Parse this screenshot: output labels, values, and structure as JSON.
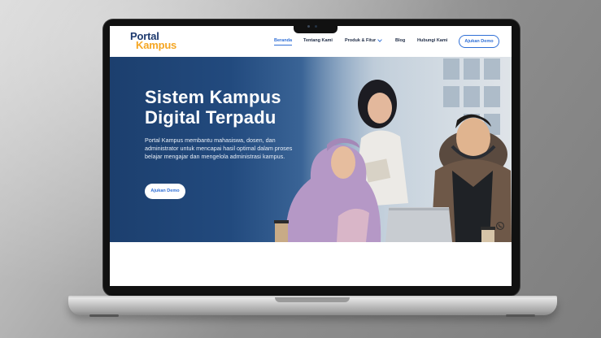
{
  "logo": {
    "line1": "Portal",
    "line2": "Kampus"
  },
  "nav": {
    "items": [
      {
        "label": "Beranda",
        "active": true
      },
      {
        "label": "Tentang Kami",
        "active": false
      },
      {
        "label": "Produk & Fitur",
        "active": false,
        "dropdown": true
      },
      {
        "label": "Blog",
        "active": false
      },
      {
        "label": "Hubungi Kami",
        "active": false
      }
    ],
    "cta_label": "Ajukan Demo"
  },
  "hero": {
    "title_line1": "Sistem Kampus",
    "title_line2": "Digital Terpadu",
    "description": "Portal Kampus membantu mahasiswa, dosen, dan administrator untuk mencapai hasil optimal dalam proses belajar mengajar dan mengelola administrasi kampus.",
    "cta_label": "Ajukan Demo"
  },
  "floating": {
    "icon": "whatsapp-icon"
  },
  "colors": {
    "brand_navy": "#1e3a6e",
    "brand_orange": "#f5a623",
    "accent_blue": "#2f6fd6",
    "hero_blue": "#1c3f6e"
  }
}
